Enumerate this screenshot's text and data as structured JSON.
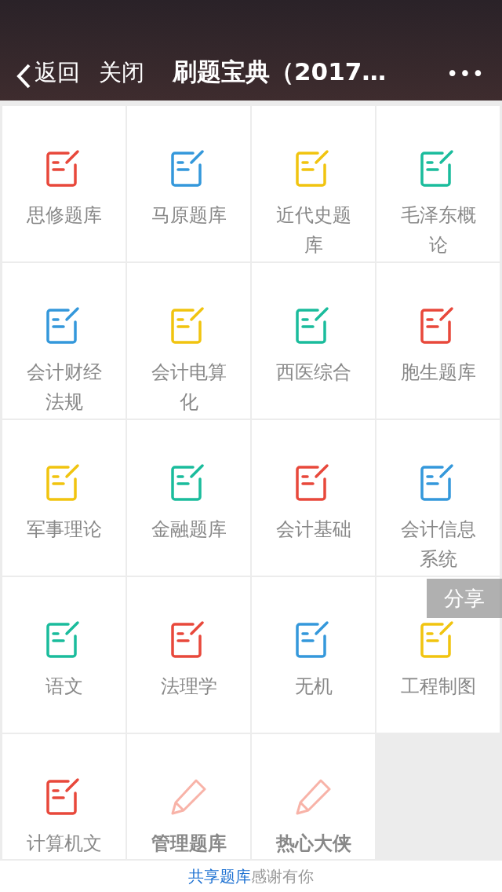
{
  "header": {
    "back": "返回",
    "close": "关闭",
    "title": "刷题宝典（2017…",
    "more": "•••"
  },
  "items": [
    {
      "label": "思修题库",
      "kind": "note",
      "color": "#e8483b"
    },
    {
      "label": "马原题库",
      "kind": "note",
      "color": "#3498db"
    },
    {
      "label": "近代史题库",
      "kind": "note",
      "color": "#f1c40f"
    },
    {
      "label": "毛泽东概论",
      "kind": "note",
      "color": "#1abc9c"
    },
    {
      "label": "会计财经法规",
      "kind": "note",
      "color": "#3498db"
    },
    {
      "label": "会计电算化",
      "kind": "note",
      "color": "#f1c40f"
    },
    {
      "label": "西医综合",
      "kind": "note",
      "color": "#1abc9c"
    },
    {
      "label": "胞生题库",
      "kind": "note",
      "color": "#e8483b"
    },
    {
      "label": "军事理论",
      "kind": "note",
      "color": "#f1c40f"
    },
    {
      "label": "金融题库",
      "kind": "note",
      "color": "#1abc9c"
    },
    {
      "label": "会计基础",
      "kind": "note",
      "color": "#e8483b"
    },
    {
      "label": "会计信息系统",
      "kind": "note",
      "color": "#3498db"
    },
    {
      "label": "语文",
      "kind": "note",
      "color": "#1abc9c"
    },
    {
      "label": "法理学",
      "kind": "note",
      "color": "#e8483b"
    },
    {
      "label": "无机",
      "kind": "note",
      "color": "#3498db"
    },
    {
      "label": "工程制图",
      "kind": "note",
      "color": "#f1c40f"
    },
    {
      "label": "计算机文",
      "kind": "note",
      "color": "#e8483b"
    },
    {
      "label": "管理题库",
      "kind": "pencil",
      "color": "#f8b3a8"
    },
    {
      "label": "热心大侠",
      "kind": "pencil",
      "color": "#f8b3a8"
    }
  ],
  "share": "分享",
  "footer": {
    "link": "共享题库",
    "text": "感谢有你"
  }
}
